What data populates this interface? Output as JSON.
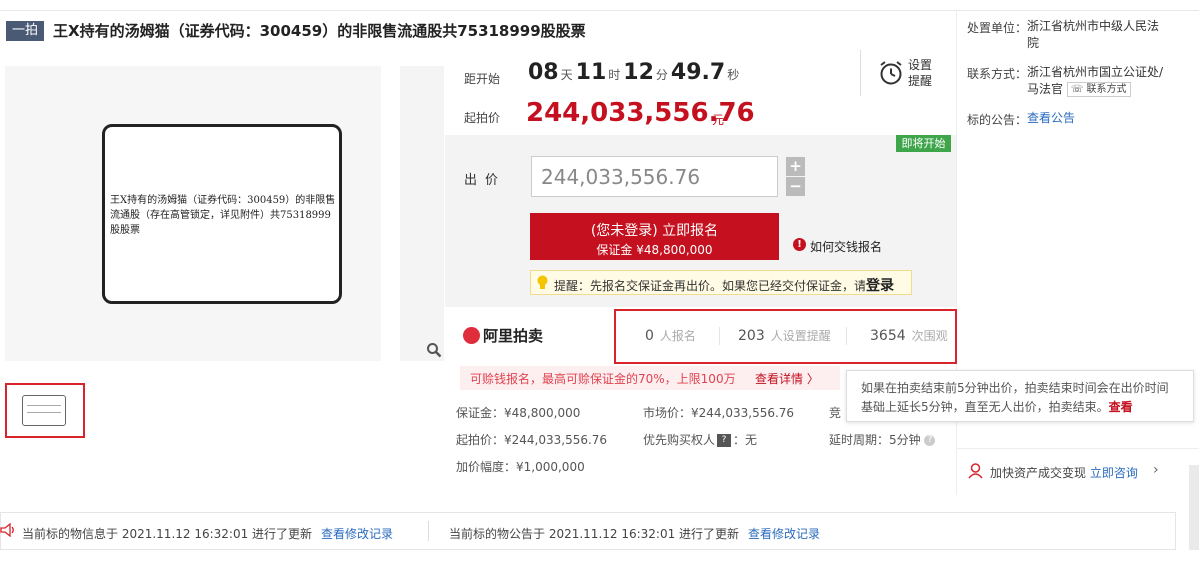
{
  "header": {
    "tag": "一拍",
    "title": "王X持有的汤姆猫（证券代码：300459）的非限售流通股共75318999股股票"
  },
  "image": {
    "doc_text": "王X持有的汤姆猫（证券代码：300459）的非限售流通股（存在高管锁定，详见附件）共75318999股股票"
  },
  "countdown": {
    "label": "距开始",
    "days": "08",
    "days_unit": "天",
    "hours": "11",
    "hours_unit": "时",
    "minutes": "12",
    "minutes_unit": "分",
    "seconds": "49.7",
    "seconds_unit": "秒",
    "remind_label": "设置提醒"
  },
  "start_price": {
    "label": "起拍价",
    "value": "244,033,556.76",
    "unit": "元"
  },
  "bid": {
    "status_tag": "即将开始",
    "label": "出价",
    "input_value": "244,033,556.76",
    "plus": "+",
    "minus": "−",
    "signup_main": "(您未登录) 立即报名",
    "signup_sub": "保证金 ¥48,800,000",
    "howto": "如何交钱报名",
    "tip_prefix": "提醒：先报名交保证金再出价。如果您已经交付保证金，请",
    "tip_login": "登录"
  },
  "stats": {
    "logo": "阿里拍卖",
    "items": [
      {
        "num": "0",
        "label": "人报名"
      },
      {
        "num": "203",
        "label": "人设置提醒"
      },
      {
        "num": "3654",
        "label": "次围观"
      }
    ]
  },
  "risk": {
    "text": "可赊钱报名，最高可赊保证金的70%，上限100万",
    "link": "查看详情 〉"
  },
  "tooltip": {
    "text": "如果在拍卖结束前5分钟出价，拍卖结束时间会在出价时间基础上延长5分钟，直至无人出价，拍卖结束。",
    "link": "查看"
  },
  "info": {
    "deposit": "保证金：¥48,800,000",
    "market_price": "市场价：¥244,033,556.76",
    "bid_type_partial": "竞",
    "start_price": "起拍价：¥244,033,556.76",
    "priority_prefix": "优先购买权人",
    "priority_badge": "?",
    "priority_suffix": "：无",
    "extend_period": "延时周期：5分钟",
    "increment": "加价幅度：¥1,000,000"
  },
  "right_panel": {
    "unit_label": "处置单位：",
    "unit_value": "浙江省杭州市中级人民法院",
    "contact_label": "联系方式：",
    "contact_value": "浙江省杭州市国立公证处/马法官",
    "contact_chip": "☏ 联系方式",
    "notice_label": "标的公告：",
    "notice_link": "查看公告",
    "accel_text": "加快资产成交变现",
    "accel_link": "立即咨询",
    "accel_arrow": "›"
  },
  "updates": {
    "info_text": "当前标的物信息于 2021.11.12 16:32:01 进行了更新",
    "info_link": "查看修改记录",
    "notice_text": "当前标的物公告于 2021.11.12 16:32:01 进行了更新",
    "notice_link": "查看修改记录"
  }
}
